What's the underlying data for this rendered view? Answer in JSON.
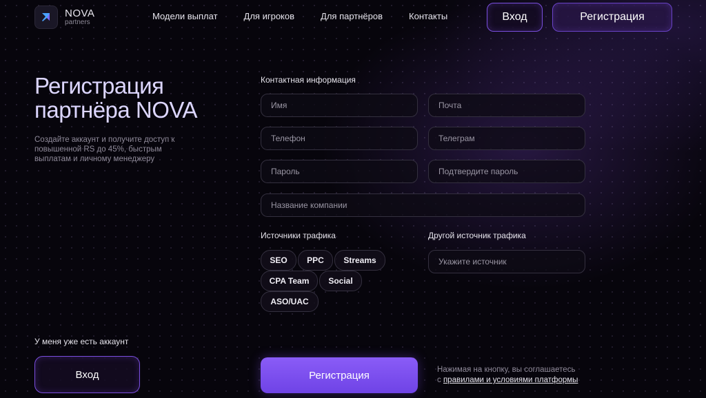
{
  "brand": {
    "name": "NOVA",
    "sub": "partners",
    "accent": "#7b4fe0",
    "logo_color": "#4aa3ff"
  },
  "nav": {
    "items": [
      {
        "label": "Модели выплат"
      },
      {
        "label": "Для игроков"
      },
      {
        "label": "Для партнёров"
      },
      {
        "label": "Контакты"
      }
    ]
  },
  "header": {
    "login_label": "Вход",
    "register_label": "Регистрация"
  },
  "hero": {
    "title_line1": "Регистрация",
    "title_line2": "партнёра NOVA",
    "subtitle": "Создайте аккаунт и получите доступ к повышенной RS до 45%, быстрым выплатам и личному менеджеру"
  },
  "account": {
    "have_account": "У меня уже есть аккаунт",
    "login_label": "Вход"
  },
  "form": {
    "contact_heading": "Контактная информация",
    "name_placeholder": "Имя",
    "email_placeholder": "Почта",
    "phone_placeholder": "Телефон",
    "telegram_placeholder": "Телеграм",
    "password_placeholder": "Пароль",
    "confirm_placeholder": "Подтвердите пароль",
    "company_placeholder": "Название компании",
    "traffic_heading": "Источники трафика",
    "other_heading": "Другой источник трафика",
    "other_placeholder": "Укажите источник",
    "chips": [
      "SEO",
      "PPC",
      "Streams",
      "CPA Team",
      "Social",
      "ASO/UAC"
    ],
    "submit_label": "Регистрация",
    "terms_prefix": "Нажимая на кнопку, вы соглашаетесь",
    "terms_c": "с",
    "terms_link": "правилами и условиями платформы"
  }
}
